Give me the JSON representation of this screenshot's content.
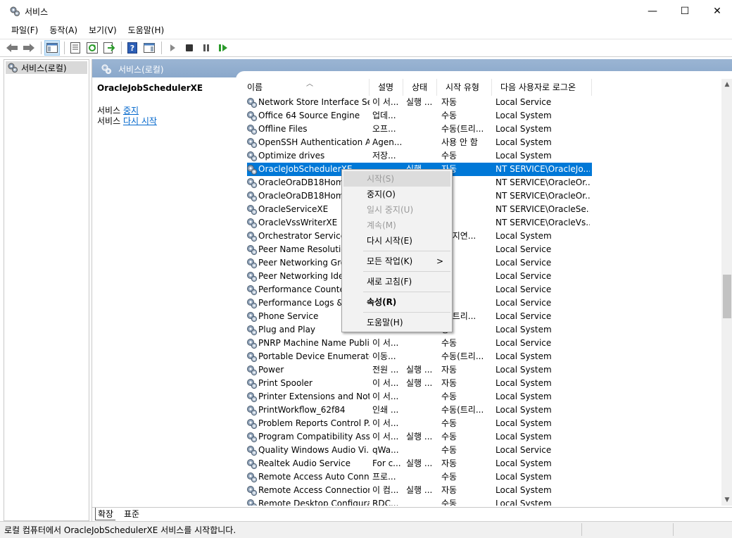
{
  "window": {
    "title": "서비스",
    "minimize": "—",
    "maximize": "☐",
    "close": "✕"
  },
  "menubar": [
    "파일(F)",
    "동작(A)",
    "보기(V)",
    "도움말(H)"
  ],
  "toolbar": {
    "buttons": [
      {
        "icon": "back-arrow-icon"
      },
      {
        "icon": "forward-arrow-icon"
      },
      {
        "icon": "console-tree-icon"
      },
      {
        "icon": "properties-icon"
      },
      {
        "icon": "refresh-icon"
      },
      {
        "icon": "export-list-icon"
      },
      {
        "icon": "help-icon"
      },
      {
        "icon": "action-pane-icon"
      },
      {
        "icon": "play-icon"
      },
      {
        "icon": "stop-icon"
      },
      {
        "icon": "pause-icon"
      },
      {
        "icon": "restart-icon"
      }
    ]
  },
  "tree": {
    "root": "서비스(로컬)"
  },
  "header": {
    "title": "서비스(로컬)"
  },
  "detail": {
    "service_name": "OracleJobSchedulerXE",
    "stop_prefix": "서비스 ",
    "stop_link": "중지",
    "restart_prefix": "서비스 ",
    "restart_link": "다시 시작"
  },
  "columns": [
    "이름",
    "설명",
    "상태",
    "시작 유형",
    "다음 사용자로 로그온"
  ],
  "rows": [
    {
      "name": "Network Store Interface Se...",
      "desc": "이 서...",
      "status": "실행 ...",
      "startup": "자동",
      "logon": "Local Service"
    },
    {
      "name": "Office 64 Source Engine",
      "desc": "업데...",
      "status": "",
      "startup": "수동",
      "logon": "Local System"
    },
    {
      "name": "Offline Files",
      "desc": "오프...",
      "status": "",
      "startup": "수동(트리...",
      "logon": "Local System"
    },
    {
      "name": "OpenSSH Authentication A...",
      "desc": "Agen...",
      "status": "",
      "startup": "사용 안 함",
      "logon": "Local System"
    },
    {
      "name": "Optimize drives",
      "desc": "저장...",
      "status": "",
      "startup": "수동",
      "logon": "Local System"
    },
    {
      "name": "OracleJobSchedulerXE",
      "desc": "",
      "status": "실행",
      "startup": "자동",
      "logon": "NT SERVICE\\OracleJo...",
      "selected": true
    },
    {
      "name": "OracleOraDB18Home1",
      "desc": "",
      "status": "",
      "startup": "동",
      "logon": "NT SERVICE\\OracleOr..."
    },
    {
      "name": "OracleOraDB18Home1",
      "desc": "",
      "status": "",
      "startup": "동",
      "logon": "NT SERVICE\\OracleOr..."
    },
    {
      "name": "OracleServiceXE",
      "desc": "",
      "status": "",
      "startup": "동",
      "logon": "NT SERVICE\\OracleSe..."
    },
    {
      "name": "OracleVssWriterXE",
      "desc": "",
      "status": "",
      "startup": "동",
      "logon": "NT SERVICE\\OracleVs..."
    },
    {
      "name": "Orchestrator Service 업",
      "desc": "",
      "status": "",
      "startup": "동(지연...",
      "logon": "Local System"
    },
    {
      "name": "Peer Name Resolution",
      "desc": "",
      "status": "",
      "startup": "동",
      "logon": "Local Service"
    },
    {
      "name": "Peer Networking Grou",
      "desc": "",
      "status": "",
      "startup": "동",
      "logon": "Local Service"
    },
    {
      "name": "Peer Networking Ident",
      "desc": "",
      "status": "",
      "startup": "동",
      "logon": "Local Service"
    },
    {
      "name": "Performance Counter",
      "desc": "",
      "status": "",
      "startup": "동",
      "logon": "Local Service"
    },
    {
      "name": "Performance Logs & A",
      "desc": "",
      "status": "",
      "startup": "동",
      "logon": "Local Service"
    },
    {
      "name": "Phone Service",
      "desc": "",
      "status": "",
      "startup": "동(트리...",
      "logon": "Local Service"
    },
    {
      "name": "Plug and Play",
      "desc": "",
      "status": "",
      "startup": "동",
      "logon": "Local System"
    },
    {
      "name": "PNRP Machine Name Publi...",
      "desc": "이 서...",
      "status": "",
      "startup": "수동",
      "logon": "Local Service"
    },
    {
      "name": "Portable Device Enumerato...",
      "desc": "이동...",
      "status": "",
      "startup": "수동(트리...",
      "logon": "Local System"
    },
    {
      "name": "Power",
      "desc": "전원 ...",
      "status": "실행 ...",
      "startup": "자동",
      "logon": "Local System"
    },
    {
      "name": "Print Spooler",
      "desc": "이 서...",
      "status": "실행 ...",
      "startup": "자동",
      "logon": "Local System"
    },
    {
      "name": "Printer Extensions and Noti...",
      "desc": "이 서...",
      "status": "",
      "startup": "수동",
      "logon": "Local System"
    },
    {
      "name": "PrintWorkflow_62f84",
      "desc": "인쇄 ...",
      "status": "",
      "startup": "수동(트리...",
      "logon": "Local System"
    },
    {
      "name": "Problem Reports Control P...",
      "desc": "이 서...",
      "status": "",
      "startup": "수동",
      "logon": "Local System"
    },
    {
      "name": "Program Compatibility Assi...",
      "desc": "이 서...",
      "status": "실행 ...",
      "startup": "수동",
      "logon": "Local System"
    },
    {
      "name": "Quality Windows Audio Vi...",
      "desc": "qWa...",
      "status": "",
      "startup": "수동",
      "logon": "Local Service"
    },
    {
      "name": "Realtek Audio Service",
      "desc": "For c...",
      "status": "실행 ...",
      "startup": "자동",
      "logon": "Local System"
    },
    {
      "name": "Remote Access Auto Conn...",
      "desc": "프로...",
      "status": "",
      "startup": "수동",
      "logon": "Local System"
    },
    {
      "name": "Remote Access Connection...",
      "desc": "이 컴...",
      "status": "실행 ...",
      "startup": "자동",
      "logon": "Local System"
    },
    {
      "name": "Remote Desktop Configura...",
      "desc": "RDC...",
      "status": "",
      "startup": "수동",
      "logon": "Local System"
    }
  ],
  "context_menu": {
    "items": [
      {
        "label": "시작(S)",
        "disabled": true
      },
      {
        "label": "중지(O)"
      },
      {
        "label": "일시 중지(U)",
        "disabled": true
      },
      {
        "label": "계속(M)",
        "disabled": true
      },
      {
        "label": "다시 시작(E)"
      },
      {
        "label": "모든 작업(K)",
        "submenu": true,
        "arrow": ">"
      },
      {
        "label": "새로 고침(F)"
      },
      {
        "label": "속성(R)",
        "bold": true
      },
      {
        "label": "도움말(H)"
      }
    ]
  },
  "tabs": [
    "확장",
    "표준"
  ],
  "statusbar": {
    "text": "로컬 컴퓨터에서 OracleJobSchedulerXE 서비스를 시작합니다."
  },
  "colors": {
    "selection": "#0078d7",
    "header_bar": "#8faacd",
    "link": "#0066cc"
  }
}
